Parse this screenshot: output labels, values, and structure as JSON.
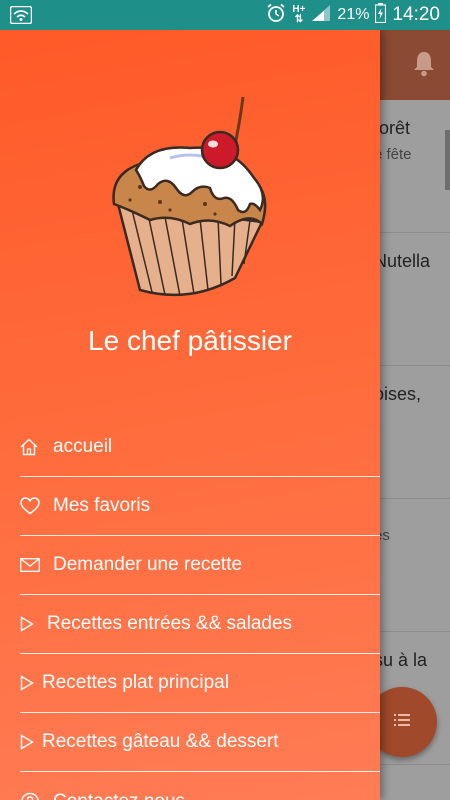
{
  "status_bar": {
    "network": "H+",
    "battery": "21%",
    "time": "14:20"
  },
  "background_list": [
    {
      "title": "forêt",
      "subtitle": "e fête"
    },
    {
      "title": "Nutella",
      "subtitle": ""
    },
    {
      "title": "oises,",
      "subtitle": ""
    },
    {
      "title": "",
      "subtitle": "es"
    },
    {
      "title": "su à la",
      "subtitle": ""
    },
    {
      "title": "",
      "subtitle": ""
    }
  ],
  "drawer": {
    "app_name": "Le chef pâtissier",
    "menu": [
      {
        "label": "accueil",
        "icon": "home-icon"
      },
      {
        "label": "Mes favoris",
        "icon": "heart-icon"
      },
      {
        "label": "Demander une recette",
        "icon": "envelope-icon"
      },
      {
        "label": "Recettes entrées && salades",
        "icon": "play-outline-icon"
      },
      {
        "label": "Recettes plat principal",
        "icon": "play-outline-icon"
      },
      {
        "label": "Recettes gâteau && dessert",
        "icon": "play-outline-icon"
      },
      {
        "label": "Contactez nous",
        "icon": "help-circle-icon"
      }
    ]
  },
  "colors": {
    "status_bar": "#1f8f89",
    "drawer_start": "#ff5a28",
    "drawer_end": "#ff7c55",
    "fab": "#a0492b"
  }
}
